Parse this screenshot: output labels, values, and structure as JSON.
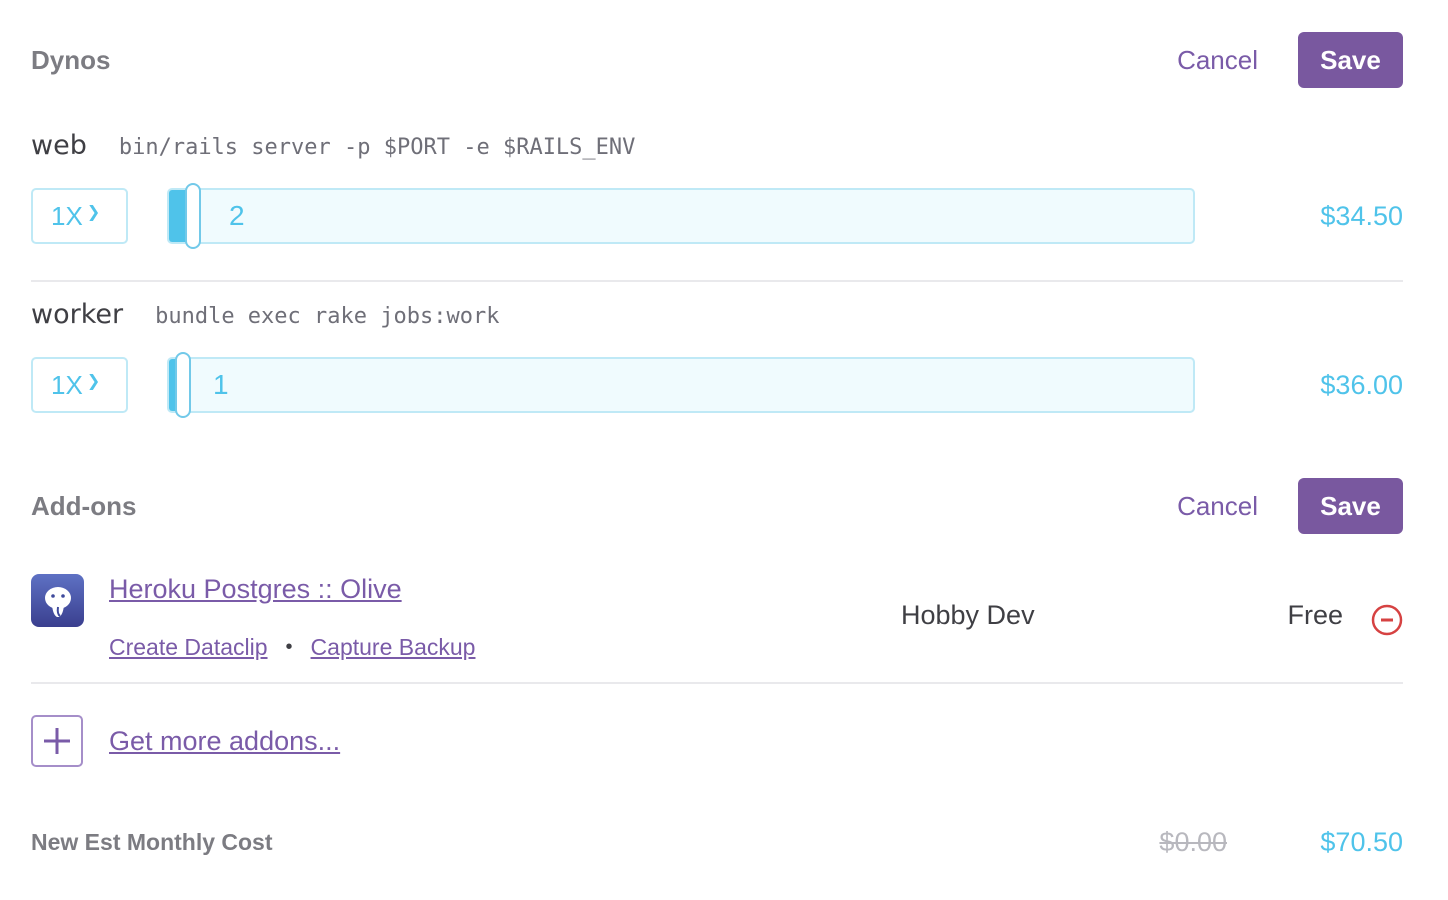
{
  "dynos_section": {
    "title": "Dynos",
    "cancel_label": "Cancel",
    "save_label": "Save"
  },
  "dynos": [
    {
      "name": "web",
      "command": "bin/rails server -p $PORT -e $RAILS_ENV",
      "size": "1X",
      "count": "2",
      "price": "$34.50"
    },
    {
      "name": "worker",
      "command": "bundle exec rake jobs:work",
      "size": "1X",
      "count": "1",
      "price": "$36.00"
    }
  ],
  "addons_section": {
    "title": "Add-ons",
    "cancel_label": "Cancel",
    "save_label": "Save"
  },
  "addons": [
    {
      "name": "Heroku Postgres :: Olive",
      "action_1": "Create Dataclip",
      "separator": "•",
      "action_2": "Capture Backup",
      "plan": "Hobby Dev",
      "price": "Free",
      "icon": "postgres-elephant-icon"
    }
  ],
  "more_addons_label": "Get more addons...",
  "cost": {
    "label": "New Est Monthly Cost",
    "old": "$0.00",
    "new": "$70.50"
  },
  "colors": {
    "accent_purple": "#79589f",
    "accent_blue": "#4fc3ea",
    "danger_red": "#d64242"
  }
}
